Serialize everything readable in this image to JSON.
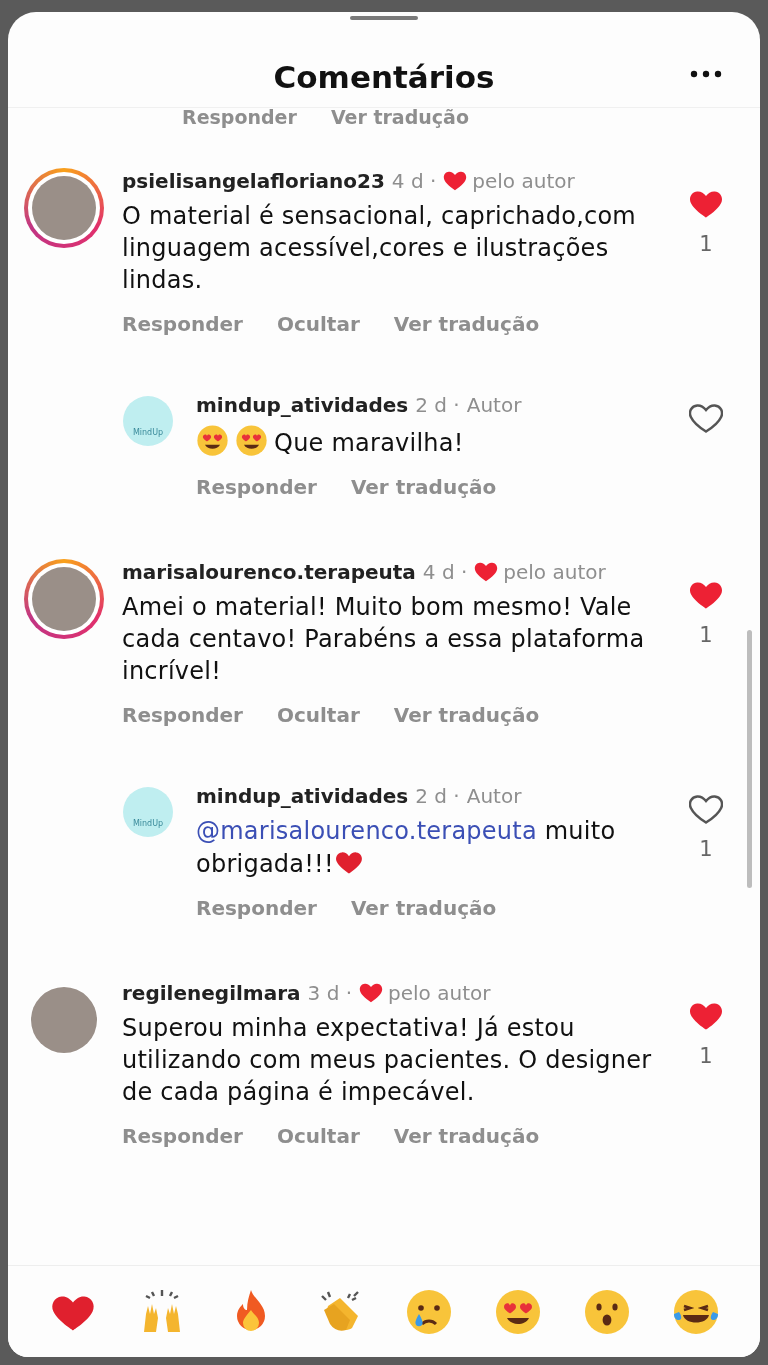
{
  "header": {
    "title": "Comentários"
  },
  "cut_actions": [
    "Responder",
    "Ver tradução"
  ],
  "comments": [
    {
      "username": "psielisangelafloriano23",
      "time": "4 d ·",
      "story_ring": true,
      "avatar": {
        "kind": "photo"
      },
      "author_like": "pelo autor",
      "text": "O material é sensacional, caprichado,com linguagem acessível,cores e ilustrações lindas.",
      "actions": [
        "Responder",
        "Ocultar",
        "Ver tradução"
      ],
      "liked": true,
      "like_count": "1",
      "replies": [
        {
          "username": "mindup_atividades",
          "time": "2 d ·",
          "author_label": "Autor",
          "avatar": {
            "kind": "logo",
            "label": "MindUp"
          },
          "leading_emoji": [
            {
              "kind": "heart_eyes"
            },
            {
              "kind": "heart_eyes"
            }
          ],
          "text": "Que maravilha!",
          "actions": [
            "Responder",
            "Ver tradução"
          ],
          "liked": false
        }
      ]
    },
    {
      "username": "marisalourenco.terapeuta",
      "time": "4 d ·",
      "story_ring": true,
      "avatar": {
        "kind": "photo"
      },
      "author_like": "pelo autor",
      "text": "Amei o material! Muito bom mesmo! Vale cada centavo! Parabéns a essa plataforma incrível!",
      "actions": [
        "Responder",
        "Ocultar",
        "Ver tradução"
      ],
      "liked": true,
      "like_count": "1",
      "replies": [
        {
          "username": "mindup_atividades",
          "time": "2 d ·",
          "author_label": "Autor",
          "avatar": {
            "kind": "logo",
            "label": "MindUp"
          },
          "mention": "@marisalourenco.terapeuta",
          "text": "muito obrigada!!!",
          "trailing_emoji": [
            {
              "kind": "heart"
            }
          ],
          "actions": [
            "Responder",
            "Ver tradução"
          ],
          "liked": false,
          "like_count": "1"
        }
      ]
    },
    {
      "username": "regilenegilmara",
      "time": "3 d ·",
      "story_ring": false,
      "avatar": {
        "kind": "photo"
      },
      "author_like": "pelo autor",
      "text": "Superou minha expectativa! Já estou utilizando com meus pacientes. O designer de cada página é  impecável.",
      "actions": [
        "Responder",
        "Ocultar",
        "Ver tradução"
      ],
      "liked": true,
      "like_count": "1"
    }
  ],
  "reactions": [
    {
      "kind": "heart"
    },
    {
      "kind": "raised_hands"
    },
    {
      "kind": "fire"
    },
    {
      "kind": "clap"
    },
    {
      "kind": "crying"
    },
    {
      "kind": "heart_eyes"
    },
    {
      "kind": "surprised"
    },
    {
      "kind": "laughing"
    }
  ]
}
